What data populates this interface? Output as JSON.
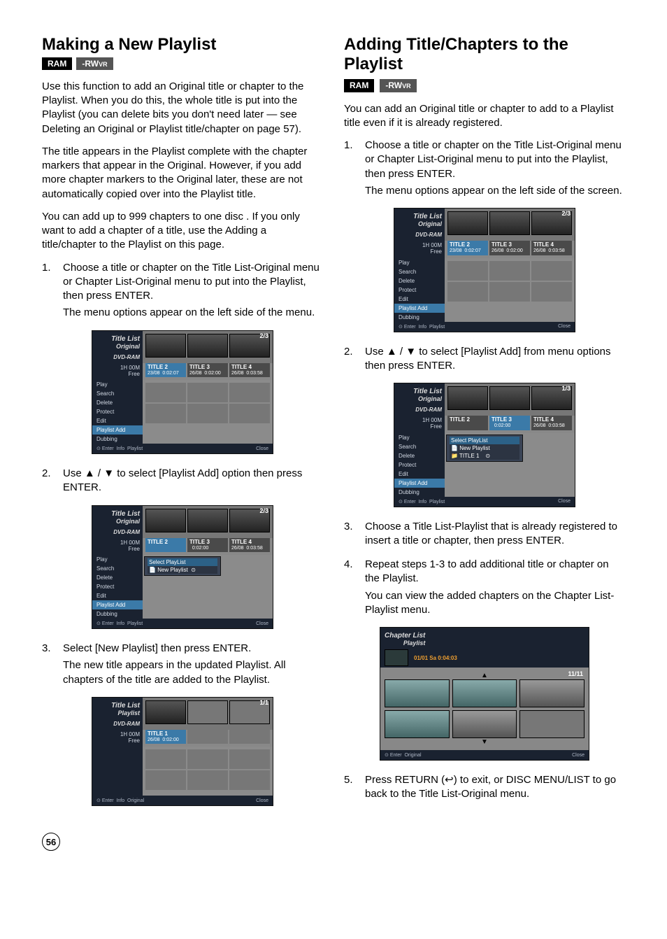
{
  "left": {
    "title": "Making a New Playlist",
    "badges": {
      "ram": "RAM",
      "rwvr_prefix": "-RW",
      "rwvr_suffix": "VR"
    },
    "p1": "Use this function to add an Original title or chapter to the Playlist. When you do this, the whole title is put into the Playlist (you can delete bits you don't need later — see Deleting an Original or Playlist title/chapter on page 57).",
    "p2": "The title appears in the Playlist complete with the chapter markers that appear in the Original. However, if you add more chapter markers to the Original later, these are not automatically copied over into the Playlist title.",
    "p3": "You can add up to 999 chapters to one disc . If you only want to add a chapter of a title, use the Adding a title/chapter to the Playlist on this page.",
    "steps": [
      {
        "num": "1.",
        "text": "Choose a title or chapter on the Title List-Original menu or Chapter List-Original menu to put into the Playlist, then press ENTER.",
        "sub": "The menu options appear on the left side of the menu."
      },
      {
        "num": "2.",
        "text": "Use ▲ / ▼ to select [Playlist Add] option then press ENTER."
      },
      {
        "num": "3.",
        "text": "Select [New Playlist] then press ENTER.",
        "sub": "The new title appears in the updated Playlist. All chapters of the title are added to the Playlist."
      }
    ]
  },
  "right": {
    "title": "Adding Title/Chapters to the Playlist",
    "badges": {
      "ram": "RAM",
      "rwvr_prefix": "-RW",
      "rwvr_suffix": "VR"
    },
    "p1": "You can add an Original title or chapter to add to a Playlist title even if it is already registered.",
    "steps": [
      {
        "num": "1.",
        "text": "Choose a title or chapter on the Title List-Original menu or Chapter List-Original menu to put into the Playlist, then press ENTER.",
        "sub": "The menu options appear on the left side of the screen."
      },
      {
        "num": "2.",
        "text": "Use ▲ / ▼ to select [Playlist Add] from menu options then press ENTER."
      },
      {
        "num": "3.",
        "text": "Choose a Title List-Playlist that is already registered to insert a title or chapter, then press ENTER."
      },
      {
        "num": "4.",
        "text": "Repeat steps 1-3 to add additional title or chapter on the Playlist.",
        "sub": "You can view the added chapters on the Chapter List-Playlist menu."
      },
      {
        "num": "5.",
        "text_a": "Press RETURN (",
        "text_b": ") to exit, or DISC MENU/LIST to go back to the Title List-Original menu."
      }
    ]
  },
  "ui": {
    "titleList": "Title List",
    "original": "Original",
    "playlistLbl": "Playlist",
    "dvdram": "DVD-RAM",
    "hdr_meta1": "1H 00M",
    "hdr_meta2": "Free",
    "page23": "2/3",
    "page13": "1/3",
    "page11": "1/1",
    "titles": [
      {
        "name": "TITLE 2",
        "date": "23/08",
        "dur": "0:02:07"
      },
      {
        "name": "TITLE 3",
        "date": "26/08",
        "dur": "0:02:00"
      },
      {
        "name": "TITLE 4",
        "date": "26/08",
        "dur": "0:03:58"
      }
    ],
    "title1": {
      "name": "TITLE 1",
      "date": "26/08",
      "dur": "0:02:00"
    },
    "menu": [
      "Play",
      "Search",
      "Delete",
      "Protect",
      "Edit",
      "Playlist Add",
      "Dubbing"
    ],
    "popup_select": "Select PlayList",
    "popup_new": "New Playlist",
    "popup_t1": "TITLE 1",
    "footer_enter": "Enter",
    "footer_info": "Info",
    "footer_playlist": "Playlist",
    "footer_original": "Original",
    "footer_close": "Close",
    "chapterList": "Chapter List",
    "ch_date": "01/01  Sa  0:04:03",
    "ch_count": "11/11"
  },
  "pageNumber": "56"
}
